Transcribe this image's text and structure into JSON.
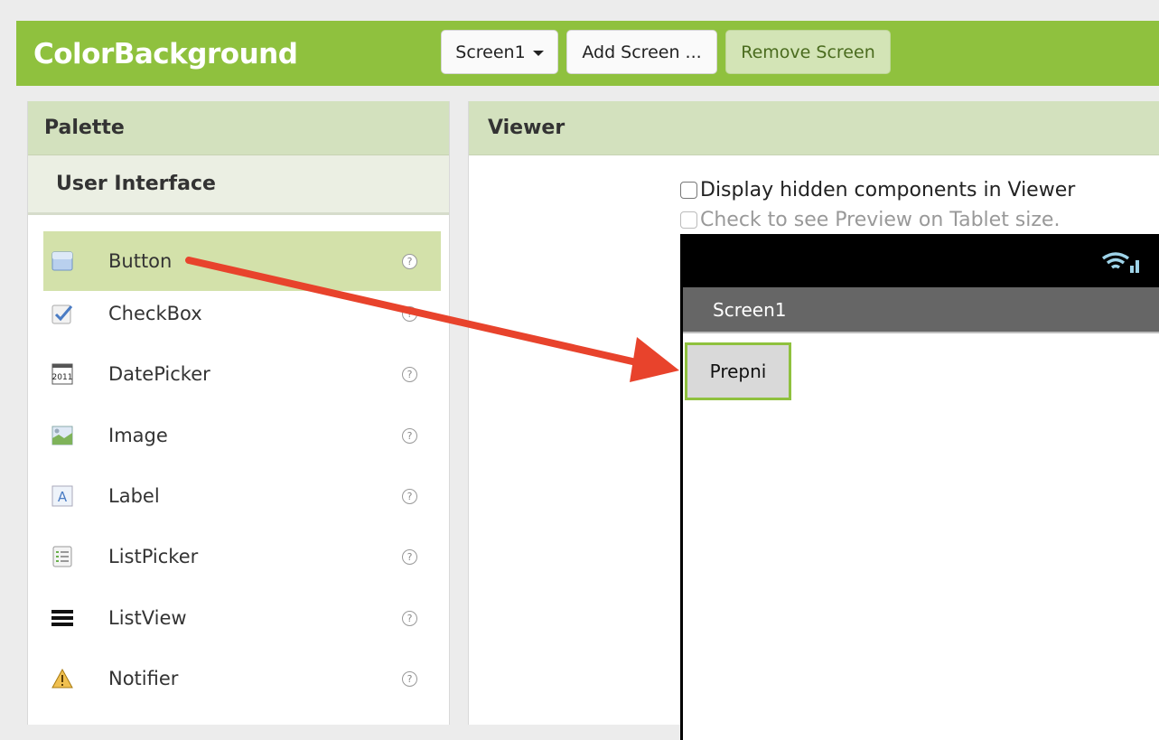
{
  "header": {
    "app_title": "ColorBackground",
    "screen_select": "Screen1",
    "add_screen": "Add Screen ...",
    "remove_screen": "Remove Screen"
  },
  "palette": {
    "title": "Palette",
    "category": "User Interface",
    "items": [
      {
        "label": "Button",
        "icon": "button-icon",
        "selected": true
      },
      {
        "label": "CheckBox",
        "icon": "checkbox-icon"
      },
      {
        "label": "DatePicker",
        "icon": "datepicker-icon"
      },
      {
        "label": "Image",
        "icon": "image-icon"
      },
      {
        "label": "Label",
        "icon": "label-icon"
      },
      {
        "label": "ListPicker",
        "icon": "listpicker-icon"
      },
      {
        "label": "ListView",
        "icon": "listview-icon"
      },
      {
        "label": "Notifier",
        "icon": "notifier-icon"
      }
    ],
    "help_glyph": "?",
    "datepicker_icon_text": "2011",
    "label_icon_text": "A"
  },
  "viewer": {
    "title": "Viewer",
    "display_hidden": "Display hidden components in Viewer",
    "tablet_preview": "Check to see Preview on Tablet size.",
    "phone": {
      "screen_title": "Screen1",
      "button_text": "Prepni"
    }
  },
  "colors": {
    "accent_green": "#8fc13e",
    "arrow_red": "#e8432c"
  }
}
